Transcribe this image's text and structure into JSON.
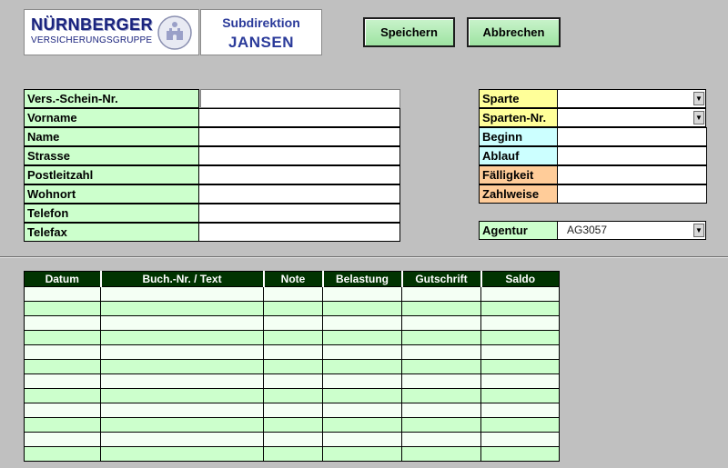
{
  "logo": {
    "brand": "NÜRNBERGER",
    "subtitle": "VERSICHERUNGSGRUPPE",
    "emblem_icon": "castle-emblem-icon"
  },
  "subdirektion": {
    "title": "Subdirektion",
    "name": "JANSEN"
  },
  "toolbar": {
    "save_label": "Speichern",
    "cancel_label": "Abbrechen"
  },
  "customer_fields": [
    {
      "label": "Vers.-Schein-Nr.",
      "value": ""
    },
    {
      "label": "Vorname",
      "value": ""
    },
    {
      "label": "Name",
      "value": ""
    },
    {
      "label": "Strasse",
      "value": ""
    },
    {
      "label": "Postleitzahl",
      "value": ""
    },
    {
      "label": "Wohnort",
      "value": ""
    },
    {
      "label": "Telefon",
      "value": ""
    },
    {
      "label": "Telefax",
      "value": ""
    }
  ],
  "contract_fields": [
    {
      "label": "Sparte",
      "value": "",
      "color": "#ffff99",
      "dropdown": true
    },
    {
      "label": "Sparten-Nr.",
      "value": "",
      "color": "#ffff99",
      "dropdown": true
    },
    {
      "label": "Beginn",
      "value": "",
      "color": "#ccffff"
    },
    {
      "label": "Ablauf",
      "value": "",
      "color": "#ccffff"
    },
    {
      "label": "Fälligkeit",
      "value": "",
      "color": "#ffcc99"
    },
    {
      "label": "Zahlweise",
      "value": "",
      "color": "#ffcc99"
    }
  ],
  "agentur": {
    "label": "Agentur",
    "value": "AG3057",
    "color": "#ccffcc"
  },
  "ledger": {
    "columns": [
      "Datum",
      "Buch.-Nr. / Text",
      "Note",
      "Belastung",
      "Gutschrift",
      "Saldo"
    ],
    "header_color": "#003300",
    "row_colors": [
      "#f4fff4",
      "#ccffcc"
    ]
  }
}
